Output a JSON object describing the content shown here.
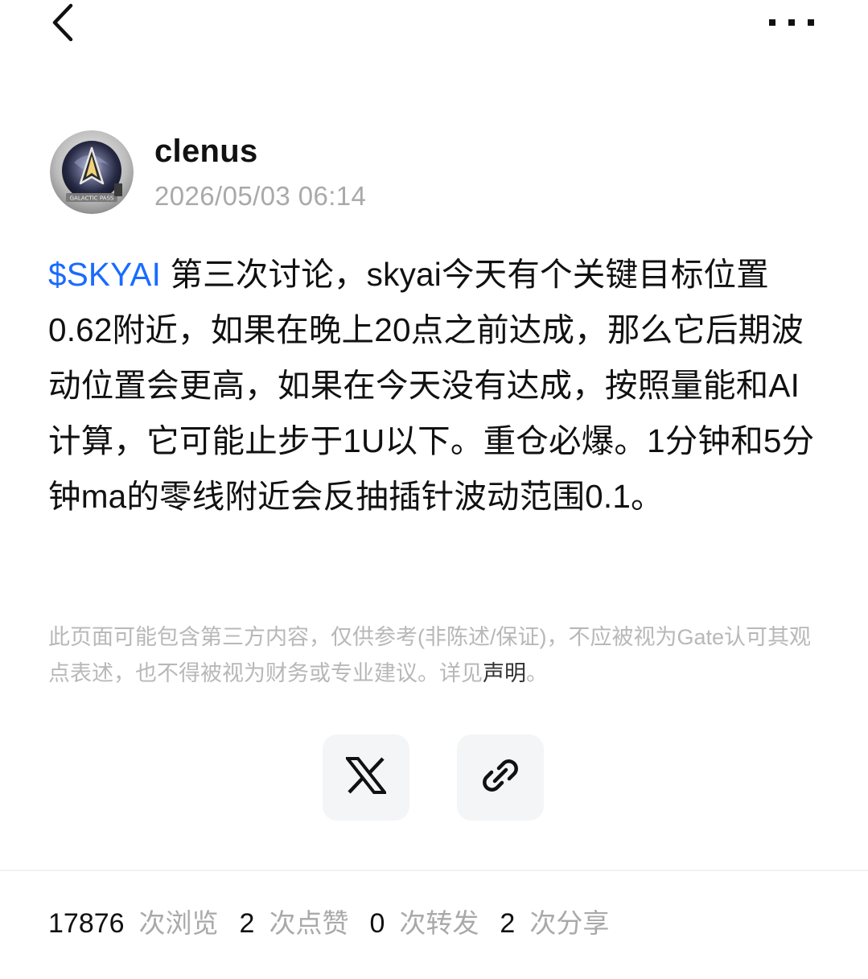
{
  "nav": {
    "back_icon": "chevron-left-icon",
    "more_icon": "more-horizontal-icon"
  },
  "author": {
    "name": "clenus",
    "time": "2026/05/03 06:14",
    "avatar_text": "GALACTIC PASS"
  },
  "post": {
    "ticker": "$SKYAI",
    "text": " 第三次讨论，skyai今天有个关键目标位置0.62附近，如果在晚上20点之前达成，那么它后期波动位置会更高，如果在今天没有达成，按照量能和AI计算，它可能止步于1U以下。重仓必爆。1分钟和5分钟ma的零线附近会反抽插针波动范围0.1。"
  },
  "disclaimer": {
    "text": "此页面可能包含第三方内容，仅供参考(非陈述/保证)，不应被视为Gate认可其观点表述，也不得被视为财务或专业建议。详见",
    "link": "声明",
    "end": "。"
  },
  "share": {
    "x_icon": "x-logo-icon",
    "link_icon": "link-icon"
  },
  "stats": [
    {
      "value": "17876",
      "label": "次浏览"
    },
    {
      "value": "2",
      "label": "次点赞"
    },
    {
      "value": "0",
      "label": "次转发"
    },
    {
      "value": "2",
      "label": "次分享"
    }
  ],
  "colors": {
    "accent": "#1a6bff",
    "muted": "#a9a9a9",
    "button_bg": "#f4f5f7"
  }
}
